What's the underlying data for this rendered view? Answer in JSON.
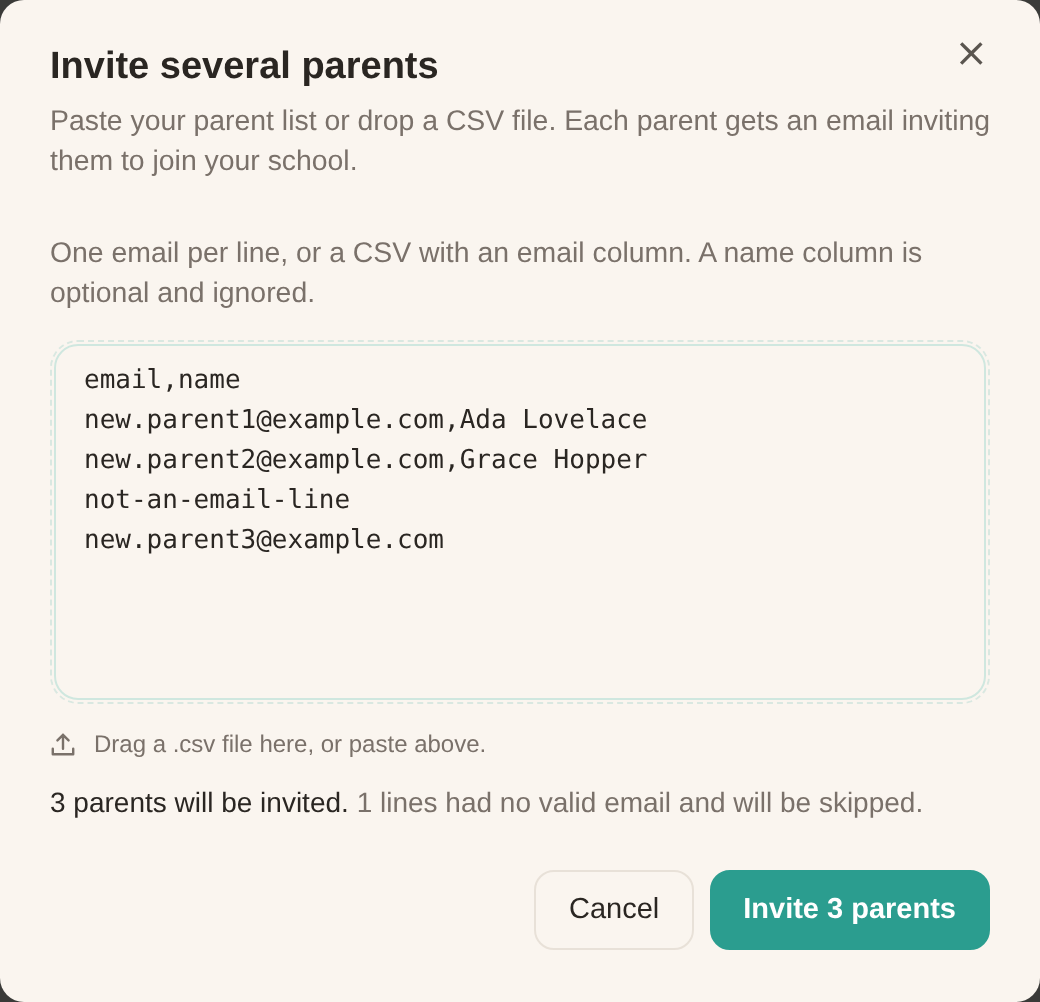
{
  "dialog": {
    "title": "Invite several parents",
    "description": "Paste your parent list or drop a CSV file. Each parent gets an email inviting them to join your school.",
    "close": "×",
    "hint": "One email per line, or a CSV with an email column. A name column is optional and ignored.",
    "input_lines": [
      "email,name",
      "new.parent1@example.com,Ada Lovelace",
      "new.parent2@example.com,Grace Hopper",
      "not-an-email-line",
      "new.parent3@example.com"
    ],
    "drop_hint": "Drag a .csv file here, or paste above.",
    "summary": {
      "valid": "3 parents will be invited.",
      "skipped": "1 lines had no valid email and will be skipped."
    },
    "buttons": [
      {
        "label": "Cancel",
        "kind": "secondary"
      },
      {
        "label": "Invite 3 parents",
        "kind": "primary"
      }
    ]
  }
}
